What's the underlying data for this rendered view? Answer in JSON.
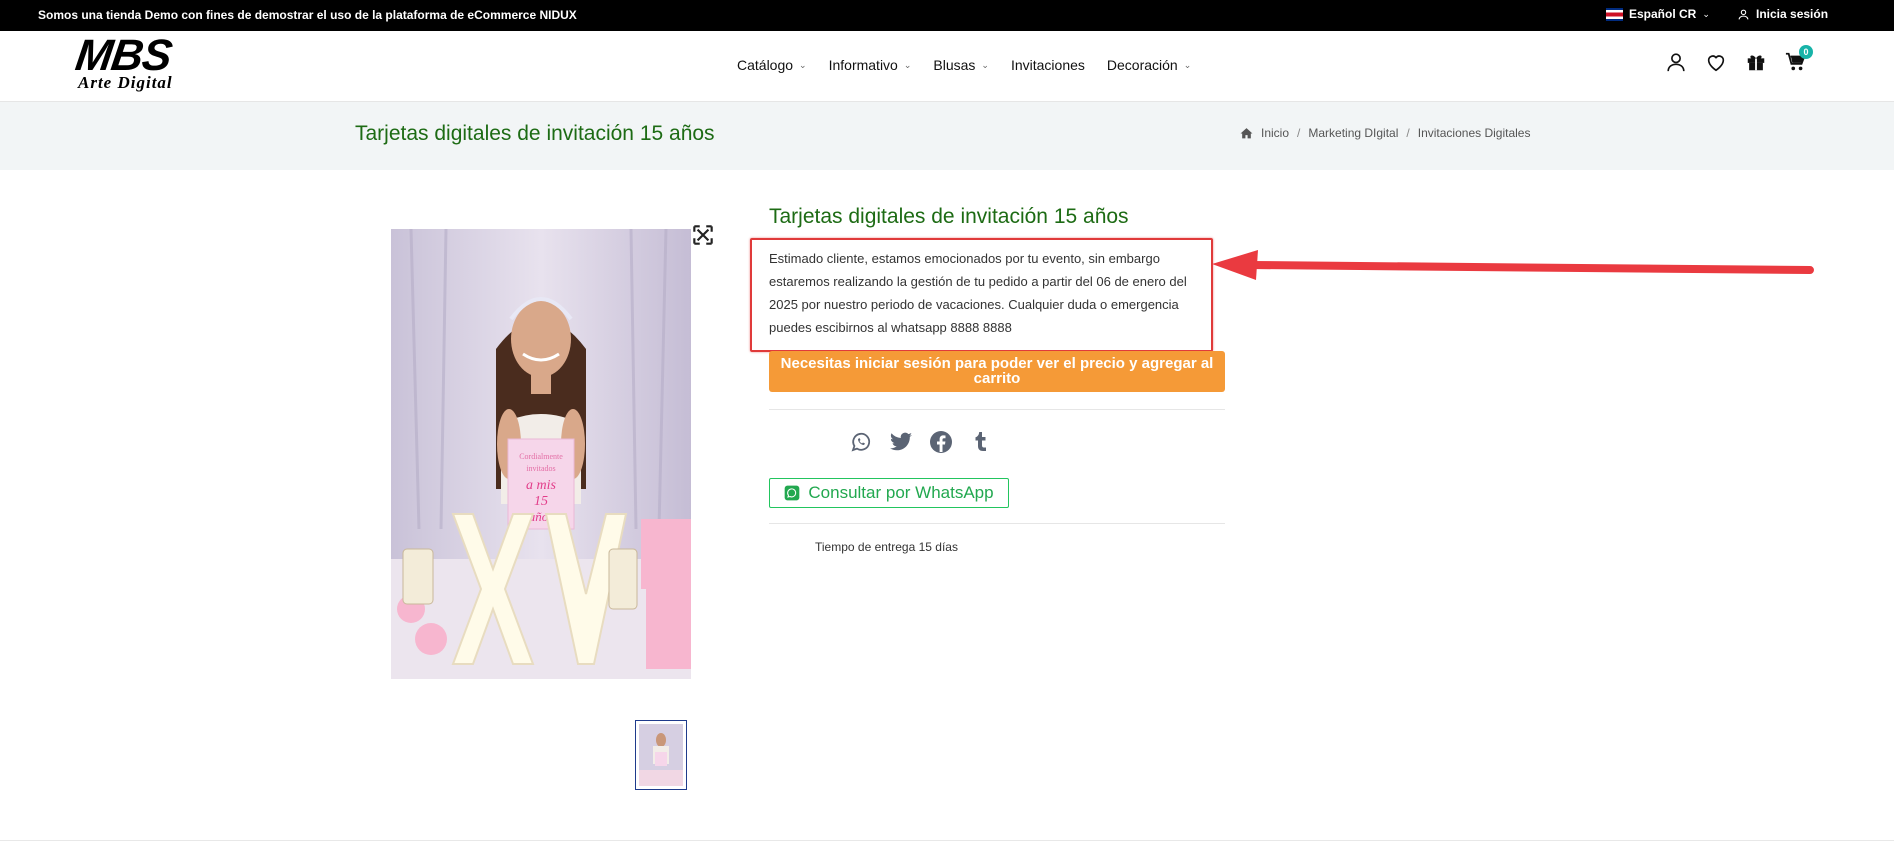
{
  "topbar": {
    "promo": "Somos una tienda Demo con fines de demostrar el uso de la plataforma de eCommerce NIDUX",
    "language": "Español CR",
    "login": "Inicia sesión"
  },
  "logo": {
    "line1": "MBS",
    "line2": "Arte Digital"
  },
  "nav": [
    "Catálogo",
    "Informativo",
    "Blusas",
    "Invitaciones",
    "Decoración"
  ],
  "cart": {
    "count": "0"
  },
  "page": {
    "title": "Tarjetas digitales de invitación 15 años",
    "breadcrumb": [
      "Inicio",
      "Marketing DIgital",
      "Invitaciones Digitales"
    ]
  },
  "product": {
    "title": "Tarjetas digitales de invitación 15 años",
    "notice": "Estimado cliente, estamos emocionados por tu evento, sin embargo estaremos realizando la gestión de tu pedido a partir del 06 de enero del 2025 por nuestro periodo de vacaciones. Cualquier duda o emergencia puedes escibirnos al whatsapp 8888 8888",
    "login_button": "Necesitas iniciar sesión para poder ver el precio y agregar al carrito",
    "whatsapp_button": "Consultar por WhatsApp",
    "delivery": "Tiempo de entrega 15 días",
    "sign_text": {
      "l1": "Cordialmente",
      "l2": "invitados",
      "l3": "a mis",
      "l4": "15",
      "l5": "años"
    }
  },
  "colors": {
    "accent_green": "#1d6b14",
    "orange": "#f59a37",
    "whatsapp": "#22c55e",
    "highlight_red": "#e03a3a"
  }
}
